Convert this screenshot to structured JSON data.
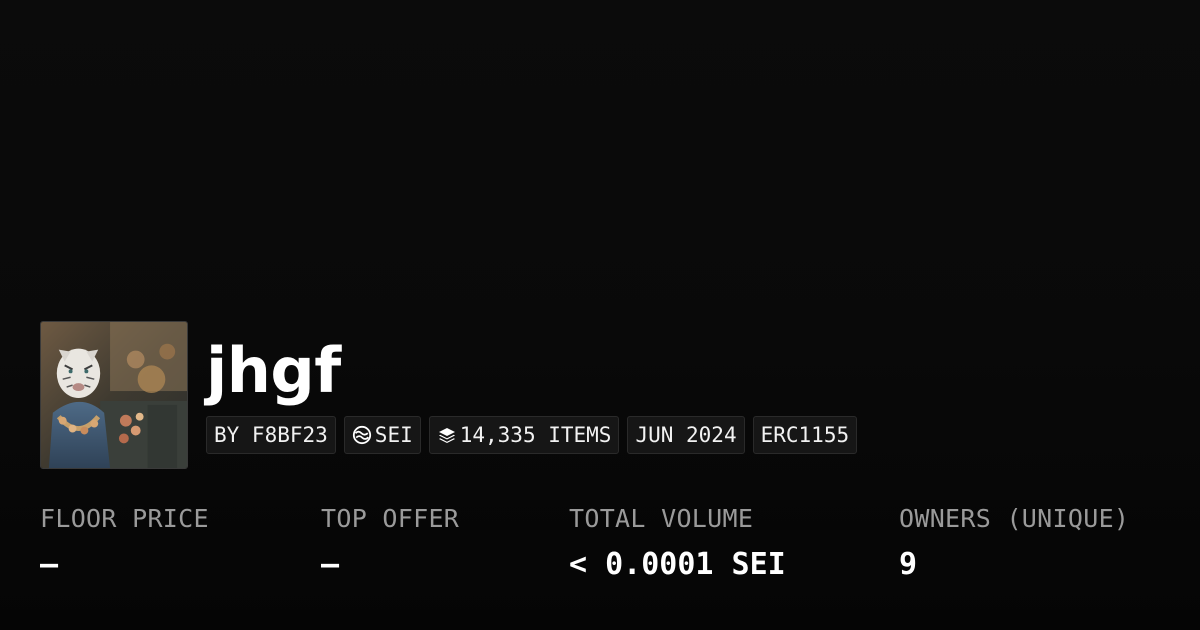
{
  "collection": {
    "name": "jhgf",
    "thumbnail_alt": "White tiger character in ornate robes with flowers"
  },
  "tags": {
    "creator": "BY F8BF23",
    "chain": "SEI",
    "chain_icon": "sei-logo-icon",
    "items": "14,335 ITEMS",
    "items_icon": "layers-icon",
    "created": "JUN 2024",
    "standard": "ERC1155"
  },
  "stats": {
    "floor_price": {
      "label": "FLOOR PRICE",
      "value": "–"
    },
    "top_offer": {
      "label": "TOP OFFER",
      "value": "–"
    },
    "total_volume": {
      "label": "TOTAL VOLUME",
      "value": "< 0.0001 SEI"
    },
    "owners": {
      "label": "OWNERS (UNIQUE)",
      "value": "9"
    }
  },
  "colors": {
    "background": "#0a0a0a",
    "label": "#9a9a9a",
    "value": "#ffffff",
    "tag_bg": "#161616"
  }
}
